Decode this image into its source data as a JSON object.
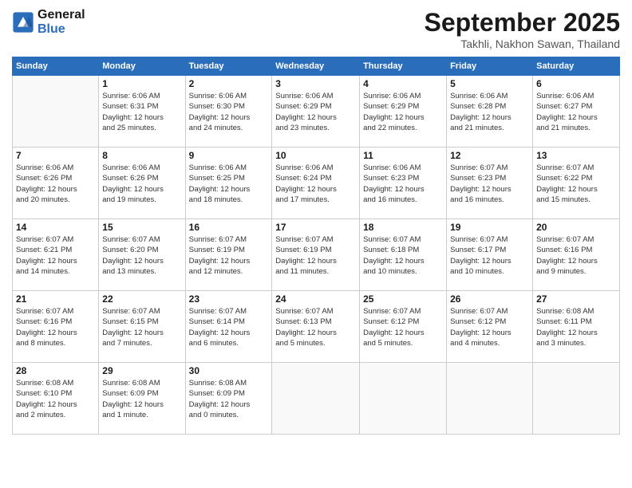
{
  "header": {
    "logo_line1": "General",
    "logo_line2": "Blue",
    "month": "September 2025",
    "location": "Takhli, Nakhon Sawan, Thailand"
  },
  "days_of_week": [
    "Sunday",
    "Monday",
    "Tuesday",
    "Wednesday",
    "Thursday",
    "Friday",
    "Saturday"
  ],
  "weeks": [
    [
      {
        "day": "",
        "info": ""
      },
      {
        "day": "1",
        "info": "Sunrise: 6:06 AM\nSunset: 6:31 PM\nDaylight: 12 hours\nand 25 minutes."
      },
      {
        "day": "2",
        "info": "Sunrise: 6:06 AM\nSunset: 6:30 PM\nDaylight: 12 hours\nand 24 minutes."
      },
      {
        "day": "3",
        "info": "Sunrise: 6:06 AM\nSunset: 6:29 PM\nDaylight: 12 hours\nand 23 minutes."
      },
      {
        "day": "4",
        "info": "Sunrise: 6:06 AM\nSunset: 6:29 PM\nDaylight: 12 hours\nand 22 minutes."
      },
      {
        "day": "5",
        "info": "Sunrise: 6:06 AM\nSunset: 6:28 PM\nDaylight: 12 hours\nand 21 minutes."
      },
      {
        "day": "6",
        "info": "Sunrise: 6:06 AM\nSunset: 6:27 PM\nDaylight: 12 hours\nand 21 minutes."
      }
    ],
    [
      {
        "day": "7",
        "info": "Sunrise: 6:06 AM\nSunset: 6:26 PM\nDaylight: 12 hours\nand 20 minutes."
      },
      {
        "day": "8",
        "info": "Sunrise: 6:06 AM\nSunset: 6:26 PM\nDaylight: 12 hours\nand 19 minutes."
      },
      {
        "day": "9",
        "info": "Sunrise: 6:06 AM\nSunset: 6:25 PM\nDaylight: 12 hours\nand 18 minutes."
      },
      {
        "day": "10",
        "info": "Sunrise: 6:06 AM\nSunset: 6:24 PM\nDaylight: 12 hours\nand 17 minutes."
      },
      {
        "day": "11",
        "info": "Sunrise: 6:06 AM\nSunset: 6:23 PM\nDaylight: 12 hours\nand 16 minutes."
      },
      {
        "day": "12",
        "info": "Sunrise: 6:07 AM\nSunset: 6:23 PM\nDaylight: 12 hours\nand 16 minutes."
      },
      {
        "day": "13",
        "info": "Sunrise: 6:07 AM\nSunset: 6:22 PM\nDaylight: 12 hours\nand 15 minutes."
      }
    ],
    [
      {
        "day": "14",
        "info": "Sunrise: 6:07 AM\nSunset: 6:21 PM\nDaylight: 12 hours\nand 14 minutes."
      },
      {
        "day": "15",
        "info": "Sunrise: 6:07 AM\nSunset: 6:20 PM\nDaylight: 12 hours\nand 13 minutes."
      },
      {
        "day": "16",
        "info": "Sunrise: 6:07 AM\nSunset: 6:19 PM\nDaylight: 12 hours\nand 12 minutes."
      },
      {
        "day": "17",
        "info": "Sunrise: 6:07 AM\nSunset: 6:19 PM\nDaylight: 12 hours\nand 11 minutes."
      },
      {
        "day": "18",
        "info": "Sunrise: 6:07 AM\nSunset: 6:18 PM\nDaylight: 12 hours\nand 10 minutes."
      },
      {
        "day": "19",
        "info": "Sunrise: 6:07 AM\nSunset: 6:17 PM\nDaylight: 12 hours\nand 10 minutes."
      },
      {
        "day": "20",
        "info": "Sunrise: 6:07 AM\nSunset: 6:16 PM\nDaylight: 12 hours\nand 9 minutes."
      }
    ],
    [
      {
        "day": "21",
        "info": "Sunrise: 6:07 AM\nSunset: 6:16 PM\nDaylight: 12 hours\nand 8 minutes."
      },
      {
        "day": "22",
        "info": "Sunrise: 6:07 AM\nSunset: 6:15 PM\nDaylight: 12 hours\nand 7 minutes."
      },
      {
        "day": "23",
        "info": "Sunrise: 6:07 AM\nSunset: 6:14 PM\nDaylight: 12 hours\nand 6 minutes."
      },
      {
        "day": "24",
        "info": "Sunrise: 6:07 AM\nSunset: 6:13 PM\nDaylight: 12 hours\nand 5 minutes."
      },
      {
        "day": "25",
        "info": "Sunrise: 6:07 AM\nSunset: 6:12 PM\nDaylight: 12 hours\nand 5 minutes."
      },
      {
        "day": "26",
        "info": "Sunrise: 6:07 AM\nSunset: 6:12 PM\nDaylight: 12 hours\nand 4 minutes."
      },
      {
        "day": "27",
        "info": "Sunrise: 6:08 AM\nSunset: 6:11 PM\nDaylight: 12 hours\nand 3 minutes."
      }
    ],
    [
      {
        "day": "28",
        "info": "Sunrise: 6:08 AM\nSunset: 6:10 PM\nDaylight: 12 hours\nand 2 minutes."
      },
      {
        "day": "29",
        "info": "Sunrise: 6:08 AM\nSunset: 6:09 PM\nDaylight: 12 hours\nand 1 minute."
      },
      {
        "day": "30",
        "info": "Sunrise: 6:08 AM\nSunset: 6:09 PM\nDaylight: 12 hours\nand 0 minutes."
      },
      {
        "day": "",
        "info": ""
      },
      {
        "day": "",
        "info": ""
      },
      {
        "day": "",
        "info": ""
      },
      {
        "day": "",
        "info": ""
      }
    ]
  ]
}
